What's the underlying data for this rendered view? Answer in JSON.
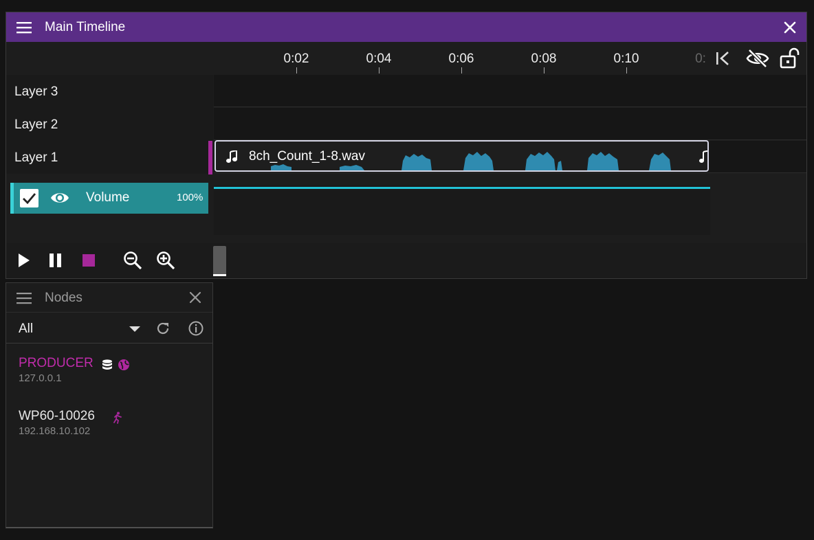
{
  "timeline": {
    "title": "Main Timeline",
    "ruler_ticks": [
      "0:02",
      "0:04",
      "0:06",
      "0:08",
      "0:10",
      "0:"
    ],
    "layers": [
      {
        "label": "Layer 3"
      },
      {
        "label": "Layer 2"
      },
      {
        "label": "Layer 1"
      }
    ],
    "clip": {
      "name": "8ch_Count_1-8.wav",
      "icon": "music-note-icon"
    },
    "volume": {
      "label": "Volume",
      "percent": "100%",
      "checked": true,
      "visible": true,
      "level": 1.0
    },
    "transport": [
      "play",
      "pause",
      "stop",
      "zoom-out",
      "zoom-in"
    ],
    "controls": [
      "skip-to-start",
      "visibility-off",
      "lock-open"
    ]
  },
  "nodes_panel": {
    "title": "Nodes",
    "filter": {
      "selected": "All"
    },
    "nodes": [
      {
        "name": "PRODUCER",
        "ip": "127.0.0.1",
        "icons": [
          "database-icon",
          "globe-icon"
        ]
      },
      {
        "name": "WP60-10026",
        "ip": "192.168.10.102",
        "icons": [
          "running-person-icon"
        ]
      }
    ]
  },
  "colors": {
    "title_bar": "#5a2d86",
    "accent_magenta": "#a6289a",
    "producer_text": "#c02cab",
    "volume_row": "#258d92",
    "volume_line": "#22c2d6",
    "waveform": "#2f8bb0"
  }
}
